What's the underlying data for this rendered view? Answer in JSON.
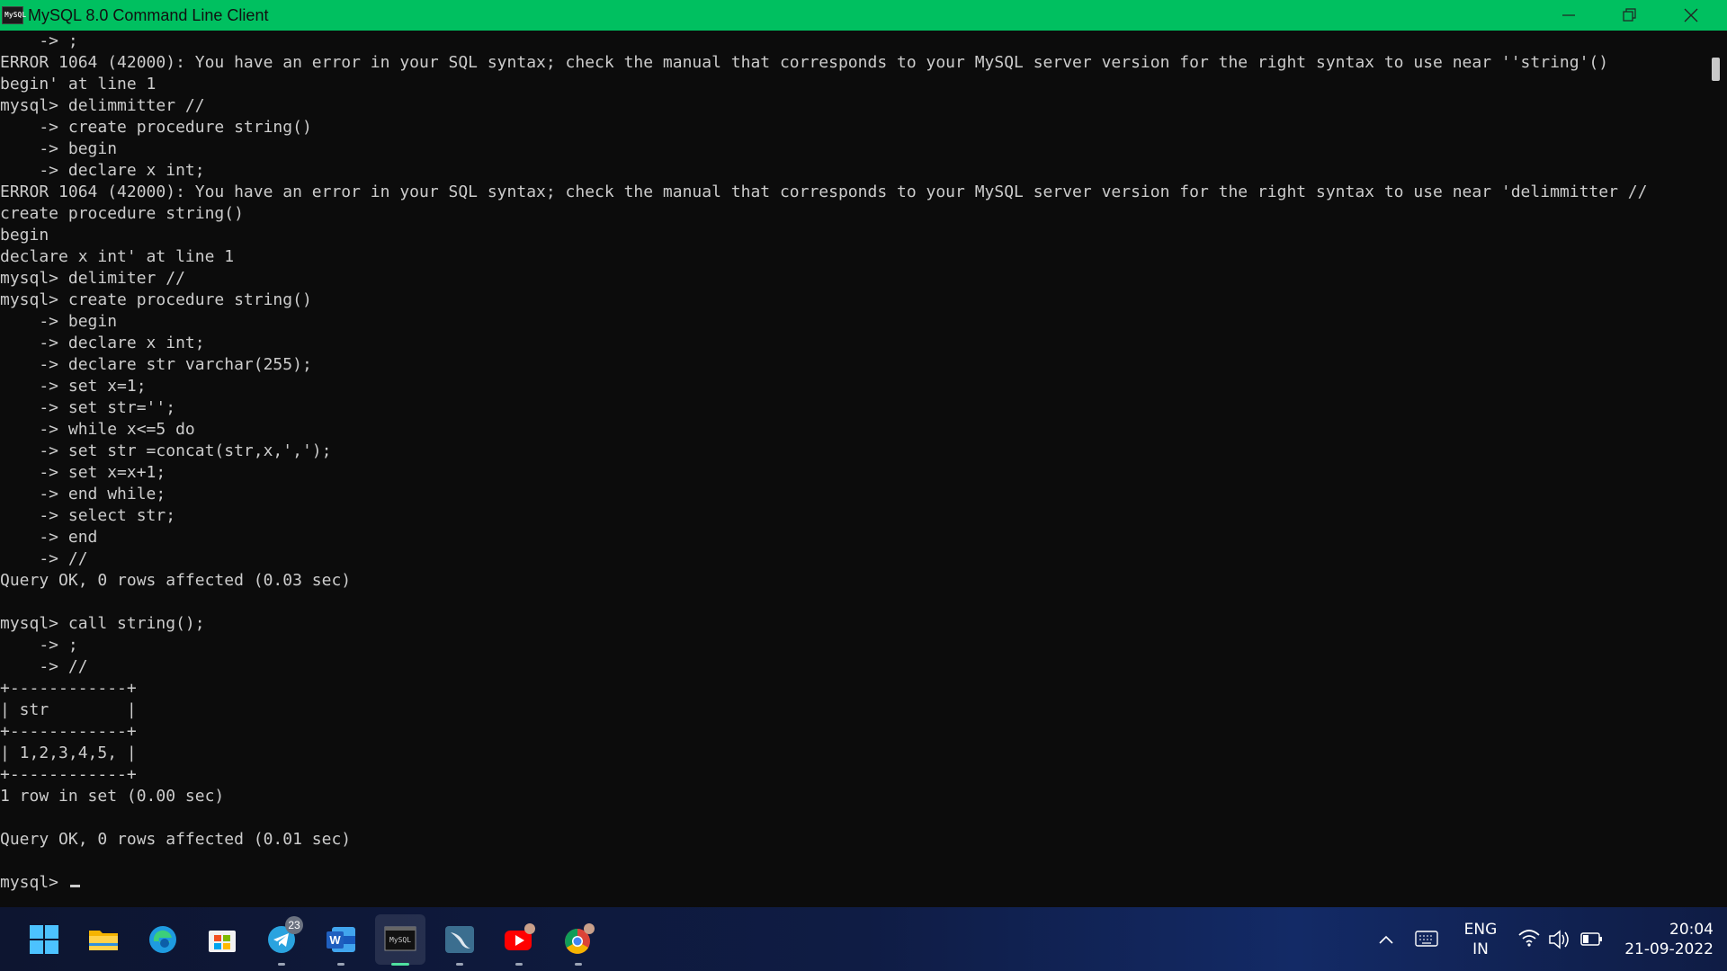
{
  "window": {
    "title": "MySQL 8.0 Command Line Client",
    "app_icon_text": "MySQL",
    "accent_color": "#00c060"
  },
  "console": {
    "lines": [
      "    -> ;",
      "ERROR 1064 (42000): You have an error in your SQL syntax; check the manual that corresponds to your MySQL server version for the right syntax to use near ''string'()",
      "begin' at line 1",
      "mysql> delimmitter //",
      "    -> create procedure string()",
      "    -> begin",
      "    -> declare x int;",
      "ERROR 1064 (42000): You have an error in your SQL syntax; check the manual that corresponds to your MySQL server version for the right syntax to use near 'delimmitter //",
      "create procedure string()",
      "begin",
      "declare x int' at line 1",
      "mysql> delimiter //",
      "mysql> create procedure string()",
      "    -> begin",
      "    -> declare x int;",
      "    -> declare str varchar(255);",
      "    -> set x=1;",
      "    -> set str='';",
      "    -> while x<=5 do",
      "    -> set str =concat(str,x,',');",
      "    -> set x=x+1;",
      "    -> end while;",
      "    -> select str;",
      "    -> end",
      "    -> //",
      "Query OK, 0 rows affected (0.03 sec)",
      "",
      "mysql> call string();",
      "    -> ;",
      "    -> //",
      "+------------+",
      "| str        |",
      "+------------+",
      "| 1,2,3,4,5, |",
      "+------------+",
      "1 row in set (0.00 sec)",
      "",
      "Query OK, 0 rows affected (0.01 sec)",
      ""
    ],
    "prompt": "mysql> "
  },
  "taskbar": {
    "apps": [
      {
        "name": "start-button",
        "icon": "windows-icon"
      },
      {
        "name": "file-explorer",
        "icon": "folder-icon"
      },
      {
        "name": "edge",
        "icon": "edge-icon"
      },
      {
        "name": "microsoft-store",
        "icon": "store-icon"
      },
      {
        "name": "telegram",
        "icon": "telegram-icon",
        "badge": "23"
      },
      {
        "name": "word",
        "icon": "word-icon"
      },
      {
        "name": "mysql-client",
        "icon": "mysql-terminal-icon"
      },
      {
        "name": "mysql-workbench",
        "icon": "dolphin-icon"
      },
      {
        "name": "youtube",
        "icon": "youtube-icon"
      },
      {
        "name": "chrome",
        "icon": "chrome-icon"
      }
    ],
    "tray": {
      "language_line1": "ENG",
      "language_line2": "IN",
      "time": "20:04",
      "date": "21-09-2022"
    }
  }
}
